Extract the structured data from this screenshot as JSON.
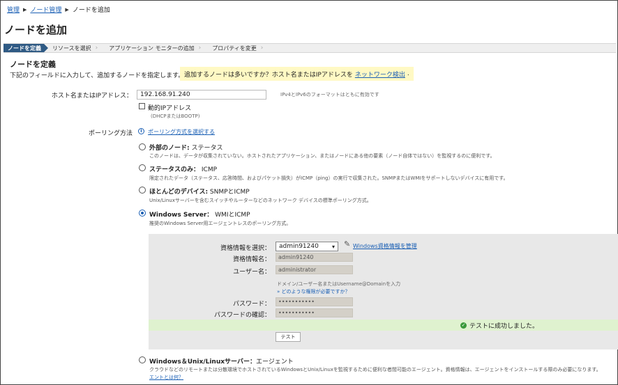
{
  "breadcrumb": {
    "root": "管理",
    "parent": "ノード管理",
    "current": "ノードを追加"
  },
  "page_title": "ノードを追加",
  "wizard": {
    "steps": [
      "ノードを定義",
      "リソースを選択",
      "アプリケーション モニターの追加",
      "プロパティを変更"
    ]
  },
  "section_title": "ノードを定義",
  "intro": "下記のフィールドに入力して、追加するノードを指定します。",
  "hint": {
    "text": "追加するノードは多いですか？ホスト名またはIPアドレスを",
    "link": "ネットワーク検出",
    "tail": "."
  },
  "host": {
    "label": "ホスト名またはIPアドレス：",
    "value": "192.168.91.240",
    "note": "IPv4とIPv6のフォーマットはともに有効です",
    "dynamic_label": "動的IPアドレス",
    "dynamic_sub": "(DHCPまたはBOOTP)"
  },
  "polling": {
    "label": "ポーリング方法",
    "help_link": "ポーリング方式を選択する",
    "options": [
      {
        "title_bold": "外部のノード:",
        "title_rest": " ステータス",
        "desc": "このノードは、データが収集されていない。ホストされたアプリケーション、またはノードにある他の要素（ノード自体ではない）を監視するのに便利です。"
      },
      {
        "title_bold": "ステータスのみ：",
        "title_rest": " ICMP",
        "desc": "限定されたデータ（ステータス、応答時間、およびパケット損失）がICMP（ping）の実行で収集された。SNMPまたはWMIをサポートしないデバイスに有用です。"
      },
      {
        "title_bold": "ほとんどのデバイス:",
        "title_rest": " SNMPとICMP",
        "desc": "Unix/Linuxサーバーを含むスイッチやルーターなどのネットワーク デバイスの標準ポーリング方式。"
      },
      {
        "title_bold": "Windows Server：",
        "title_rest": " WMIとICMP",
        "desc": "推奨のWindows Server用エージェントレスのポーリング方式。"
      },
      {
        "title_bold": "Windows＆Unix/Linuxサーバー：",
        "title_rest": "エージェント",
        "desc": "クラウドなどのリモートまたは分散環境でホストされているWindowsとUnix/Linuxを監視するために便利な者間可能のエージェント。資格情報は、エージェントをインストールする際のみ必要になります。",
        "link": "エントとは何？"
      }
    ]
  },
  "credentials": {
    "select_label": "資格情報を選択：",
    "select_value": "admin91240",
    "manage_link": "Windows資格情報を管理",
    "name_label": "資格情報名：",
    "name_value": "admin91240",
    "user_label": "ユーザー名：",
    "user_value": "administrator",
    "user_hint": "ドメイン/ユーザー名またはUsername@Domainを入力",
    "rights_link": "» どのような権限が必要ですか？",
    "password_label": "パスワード：",
    "password_value": "•••••••••••",
    "confirm_label": "パスワードの確認：",
    "confirm_value": "•••••••••••",
    "success": "テストに成功しました。",
    "test_button": "テスト"
  }
}
